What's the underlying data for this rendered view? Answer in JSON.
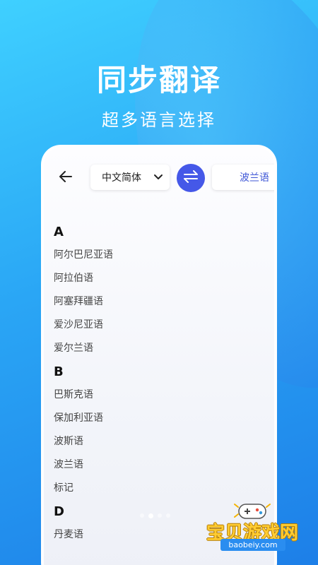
{
  "promo": {
    "headline": "同步翻译",
    "subline": "超多语言选择"
  },
  "toolbar": {
    "back_icon": "arrow-left-icon",
    "source_language": "中文简体",
    "swap_icon": "swap-arrows-icon",
    "target_language": "波兰语"
  },
  "language_list": {
    "sections": [
      {
        "letter": "A",
        "items": [
          "阿尔巴尼亚语",
          "阿拉伯语",
          "阿塞拜疆语",
          "爱沙尼亚语",
          "爱尔兰语"
        ]
      },
      {
        "letter": "B",
        "items": [
          "巴斯克语",
          "保加利亚语",
          "波斯语",
          "波兰语",
          "标记"
        ]
      },
      {
        "letter": "D",
        "items": [
          "丹麦语"
        ]
      }
    ]
  },
  "pager": {
    "total": 4,
    "active_index": 1
  },
  "watermark": {
    "title": "宝贝游戏网",
    "url": "baobeiy.com",
    "icon": "gamepad-icon"
  },
  "colors": {
    "accent": "#4558e8",
    "target_text": "#3f57d6",
    "background_top": "#3fd0ff",
    "background_bottom": "#1d7fe8"
  }
}
